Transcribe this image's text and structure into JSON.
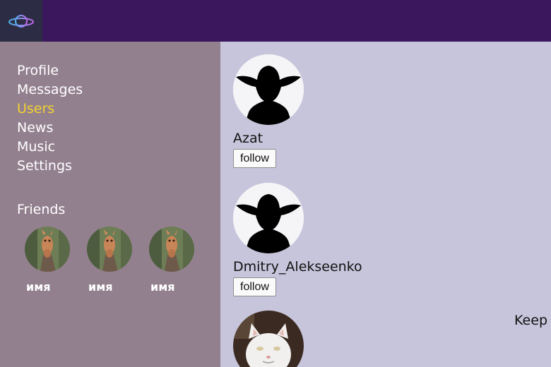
{
  "nav": {
    "items": [
      {
        "label": "Profile",
        "active": false
      },
      {
        "label": "Messages",
        "active": false
      },
      {
        "label": "Users",
        "active": true
      },
      {
        "label": "News",
        "active": false
      },
      {
        "label": "Music",
        "active": false
      },
      {
        "label": "Settings",
        "active": false
      }
    ]
  },
  "friends": {
    "title": "Friends",
    "list": [
      {
        "name": "имя"
      },
      {
        "name": "имя"
      },
      {
        "name": "имя"
      }
    ]
  },
  "users": [
    {
      "name": "Azat",
      "button": "follow",
      "avatar": "default-silhouette"
    },
    {
      "name": "Dmitry_Alekseenko",
      "button": "follow",
      "avatar": "default-silhouette"
    },
    {
      "name": "",
      "status": "Keep",
      "avatar": "cat-photo"
    }
  ],
  "colors": {
    "header": "#3b185e",
    "sidebar": "#93808f",
    "content": "#c7c5dc",
    "active_link": "#f2d32e"
  }
}
